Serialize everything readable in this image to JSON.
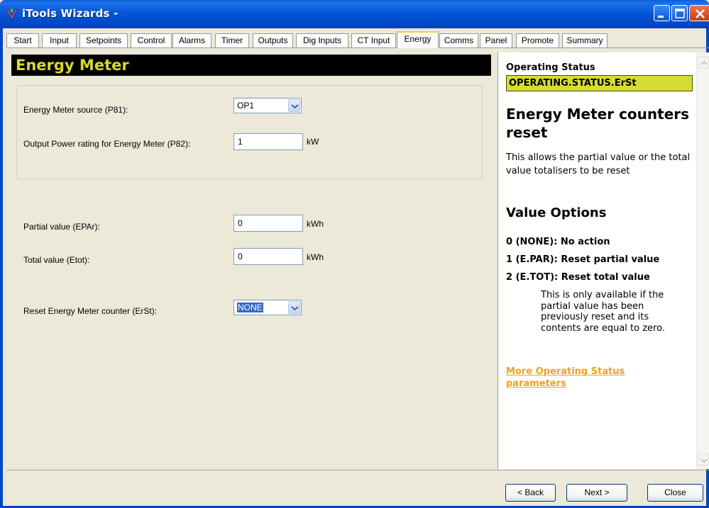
{
  "window": {
    "title": "iTools Wizards -",
    "icon": "itools-app-icon"
  },
  "tabs": [
    {
      "label": "Start"
    },
    {
      "label": "Input"
    },
    {
      "label": "Setpoints"
    },
    {
      "label": "Control"
    },
    {
      "label": "Alarms"
    },
    {
      "label": "Timer"
    },
    {
      "label": "Outputs"
    },
    {
      "label": "Dig Inputs"
    },
    {
      "label": "CT Input"
    },
    {
      "label": "Energy"
    },
    {
      "label": "Comms"
    },
    {
      "label": "Panel"
    },
    {
      "label": "Promote"
    },
    {
      "label": "Summary"
    }
  ],
  "active_tab": "Energy",
  "main": {
    "header": "Energy Meter",
    "source_label": "Energy Meter source (P81):",
    "source_value": "OP1",
    "power_label": "Output Power rating for Energy Meter (P82):",
    "power_value": "1",
    "power_unit": "kW",
    "partial_label": "Partial value (EPAr):",
    "partial_value": "0",
    "partial_unit": "kWh",
    "total_label": "Total value (Etot):",
    "total_value": "0",
    "total_unit": "kWh",
    "reset_label": "Reset Energy Meter counter (ErSt):",
    "reset_value": "NONE"
  },
  "help": {
    "section": "Operating Status",
    "parameter": "OPERATING.STATUS.ErSt",
    "title": "Energy Meter counters reset",
    "description": "This allows the partial value or the total value totalisers to be reset",
    "options_title": "Value Options",
    "options": [
      "0 (NONE): No action",
      "1 (E.PAR): Reset partial value",
      "2 (E.TOT): Reset total value"
    ],
    "note": "This is only available if the partial value has been previously reset and its contents are equal to zero.",
    "link": "More Operating Status parameters",
    "param_color": "#d6dc33",
    "link_color": "#f0a020"
  },
  "buttons": {
    "back": "< Back",
    "next": "Next >",
    "close": "Close"
  },
  "colors": {
    "titlebar": "#0055d6",
    "header_bg": "#000000",
    "header_text": "#d9d92a",
    "active_tab_accent": "#ffc83c"
  }
}
